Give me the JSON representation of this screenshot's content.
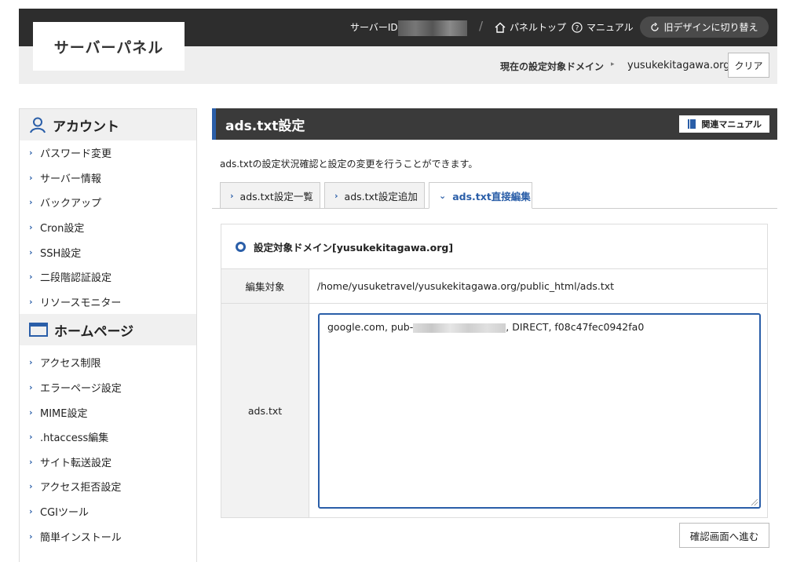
{
  "header": {
    "logo": "サーバーパネル",
    "server_id_label": "サーバーID",
    "separator": "/",
    "panel_top": "パネルトップ",
    "manual": "マニュアル",
    "switch_design": "旧デザインに切り替え",
    "current_domain_label": "現在の設定対象ドメイン",
    "current_domain": "yusukekitagawa.org",
    "clear": "クリア"
  },
  "sidebar": {
    "account_heading": "アカウント",
    "account_items": [
      "パスワード変更",
      "サーバー情報",
      "バックアップ",
      "Cron設定",
      "SSH設定",
      "二段階認証設定",
      "リソースモニター"
    ],
    "homepage_heading": "ホームページ",
    "homepage_items": [
      "アクセス制限",
      "エラーページ設定",
      "MIME設定",
      ".htaccess編集",
      "サイト転送設定",
      "アクセス拒否設定",
      "CGIツール",
      "簡単インストール"
    ]
  },
  "main": {
    "title": "ads.txt設定",
    "manual_button": "関連マニュアル",
    "description": "ads.txtの設定状況確認と設定の変更を行うことができます。",
    "tabs": [
      {
        "label": "ads.txt設定一覧",
        "active": false
      },
      {
        "label": "ads.txt設定追加",
        "active": false
      },
      {
        "label": "ads.txt直接編集",
        "active": true
      }
    ],
    "target_domain": "設定対象ドメイン[yusukekitagawa.org]",
    "edit_target_label": "編集対象",
    "edit_target_value": "/home/yusuketravel/yusukekitagawa.org/public_html/ads.txt",
    "ads_label": "ads.txt",
    "ads_content_prefix": "google.com, pub-",
    "ads_content_suffix": ", DIRECT, f08c47fec0942fa0",
    "confirm_button": "確認画面へ進む"
  },
  "colors": {
    "accent": "#2a5ea8",
    "header_dark": "#2d2d2d",
    "title_bar": "#3a3a3a"
  }
}
